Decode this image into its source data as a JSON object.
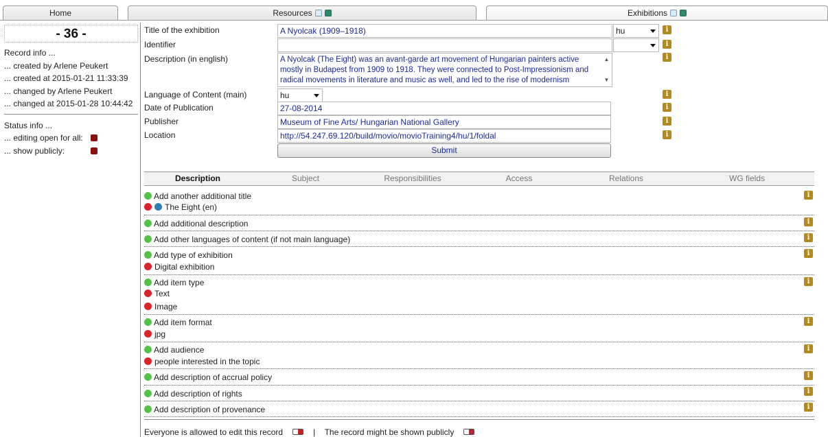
{
  "tabs": {
    "home": "Home",
    "resources": "Resources",
    "exhibitions": "Exhibitions"
  },
  "record": {
    "number": "- 36 -",
    "info_title": "Record info ...",
    "created_by": "... created by Arlene Peukert",
    "created_at": "... created at 2015-01-21 11:33:39",
    "changed_by": "... changed by Arlene Peukert",
    "changed_at": "... changed at 2015-01-28 10:44:42",
    "status_title": "Status info ...",
    "editing_open": "... editing open for all:",
    "show_publicly": "... show publicly:"
  },
  "form": {
    "title_label": "Title of the exhibition",
    "title_value": "A Nyolcak (1909–1918)",
    "title_lang": "hu",
    "identifier_label": "Identifier",
    "identifier_value": "",
    "identifier_lang": "",
    "description_label": "Description (in english)",
    "description_value": "A Nyolcak (The Eight) was an avant-garde art movement of Hungarian painters active mostly in Budapest from 1909 to 1918. They were connected to Post-Impressionism and radical movements in literature and music as well, and led to the rise of modernism",
    "language_label": "Language of Content (main)",
    "language_value": "hu",
    "date_label": "Date of Publication",
    "date_value": "27-08-2014",
    "publisher_label": "Publisher",
    "publisher_value": "Museum of Fine Arts/ Hungarian National Gallery",
    "location_label": "Location",
    "location_value": "http://54.247.69.120/build/movio/movioTraining4/hu/1/foldal",
    "submit_label": "Submit"
  },
  "subtabs": [
    "Description",
    "Subject",
    "Responsibilities",
    "Access",
    "Relations",
    "WG fields"
  ],
  "sections": {
    "additional_title": "Add another additional title",
    "additional_title_item": "The Eight (en)",
    "additional_description": "Add additional description",
    "other_languages": "Add other languages of content (if not main language)",
    "type_of_exhibition": "Add type of exhibition",
    "type_item": "Digital exhibition",
    "item_type": "Add item type",
    "item_type_1": "Text",
    "item_type_2": "Image",
    "item_format": "Add item format",
    "item_format_1": "jpg",
    "audience": "Add audience",
    "audience_1": "people interested in the topic",
    "accrual_policy": "Add description of accrual policy",
    "rights": "Add description of rights",
    "provenance": "Add description of provenance"
  },
  "footer": {
    "edit_text": "Everyone is allowed to edit this record",
    "separator": "|",
    "public_text": "The record might be shown publicly"
  },
  "icons": {
    "info": "info-icon",
    "add": "green-dot-icon",
    "remove": "red-dot-icon",
    "language": "blue-dot-icon"
  },
  "colors": {
    "add": "#55c14a",
    "remove": "#d9242a",
    "info": "#b28a1e",
    "status": "#8b1010",
    "link_text": "#1a2b9e"
  }
}
